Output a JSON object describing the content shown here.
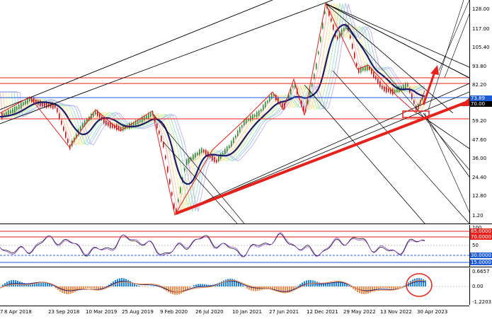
{
  "chart": {
    "main_scale": [
      "128.00",
      "117.00",
      "105.40",
      "93.80",
      "82.20",
      "70.60",
      "59.20",
      "47.60",
      "36.00",
      "24.40",
      "12.80",
      "1.20"
    ],
    "price_tags": [
      {
        "text": "73.89",
        "color": "#1e5bd8"
      },
      {
        "text": "70.00",
        "color": "#000000"
      }
    ],
    "rsi_scale": [
      "100",
      "85.0000",
      "70.0000",
      "50",
      "30.0000",
      "15.0000",
      "0.00"
    ],
    "macd_scale": [
      "0.6657",
      "0.00",
      "-1.2203"
    ],
    "time_labels": [
      "8 Apr 2018",
      "23 Sep 2018",
      "10 Mar 2019",
      "25 Aug 2019",
      "9 Feb 2020",
      "26 Jul 2020",
      "10 Jan 2021",
      "27 Jun 2021",
      "12 Dec 2021",
      "29 May 2022",
      "13 Nov 2022",
      "30 Apr 2023"
    ],
    "colors": {
      "red_line": "#e8201a",
      "blue_line": "#1e5bd8",
      "ma": "#1a1a6e",
      "up_candle": "#2e8b2e",
      "down_candle": "#c41010",
      "macd_pos": "#1e88e5",
      "macd_neg": "#f28c4a"
    }
  }
}
